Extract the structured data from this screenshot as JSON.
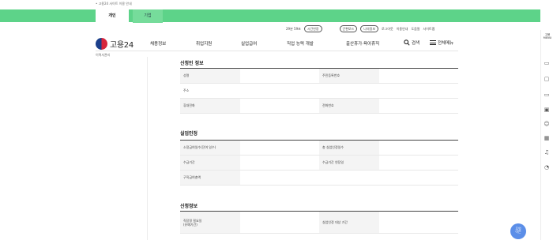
{
  "notice": {
    "text": "• 고용24 사이트 이용 안내"
  },
  "tabs": [
    {
      "label": "개인"
    },
    {
      "label": "기업"
    }
  ],
  "utility": {
    "time": "29분 59초",
    "extend": "시간연장",
    "mode": "간편모드",
    "myinfo": "나의정보",
    "logout": "로그아웃",
    "guide": "이용안내",
    "help": "도움말",
    "sitemap": "사이트맵"
  },
  "brand": {
    "name": "고용24",
    "sub": "이력서관리"
  },
  "gnb": [
    "채용정보",
    "취업지원",
    "실업급여",
    "직업 능력 개발",
    "출산휴가·육아휴직"
  ],
  "search": {
    "label": "검색"
  },
  "allmenu": {
    "label": "전체메뉴"
  },
  "sections": [
    {
      "title": "신청인 정보",
      "rows": [
        {
          "l1": "성명",
          "l2": "주민등록번호"
        },
        {
          "full": "주소"
        },
        {
          "l1": "휴대전화",
          "l2": "전화번호"
        }
      ]
    },
    {
      "title": "실업인정",
      "rows": [
        {
          "l1": "소정급여일수(잔여 일수)",
          "l2": "총 실업인정일수"
        },
        {
          "l1": "수급기간",
          "l2": "수급기간 연장일"
        },
        {
          "l1": "구직급여총액"
        }
      ]
    },
    {
      "title": "신청정보",
      "rows": [
        {
          "l1": "직장명 필요일\n(유예기간)",
          "l2": "실업인정 대상 기간"
        }
      ]
    }
  ],
  "sidebar": {
    "top_text": "고용\nMENU",
    "icons": [
      "monitor-icon",
      "chat-icon",
      "display-icon",
      "window-icon",
      "smile-icon",
      "calendar-icon",
      "headset-icon",
      "bubble-icon"
    ]
  },
  "chat": {
    "label": "무엇\n이든"
  }
}
